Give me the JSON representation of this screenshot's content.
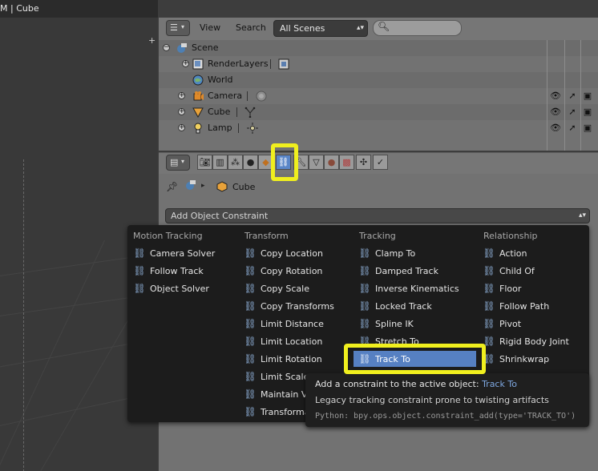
{
  "viewport": {
    "title": "M | Cube"
  },
  "outliner": {
    "menus": [
      "View",
      "Search"
    ],
    "scene_select": "All Scenes",
    "items": [
      {
        "label": "Scene"
      },
      {
        "label": "RenderLayers"
      },
      {
        "label": "World"
      },
      {
        "label": "Camera"
      },
      {
        "label": "Cube"
      },
      {
        "label": "Lamp"
      }
    ]
  },
  "properties": {
    "breadcrumb": "Cube",
    "add_constraint": "Add Object Constraint"
  },
  "menu": {
    "columns": [
      {
        "header": "Motion Tracking",
        "items": [
          "Camera Solver",
          "Follow Track",
          "Object Solver"
        ]
      },
      {
        "header": "Transform",
        "items": [
          "Copy Location",
          "Copy Rotation",
          "Copy Scale",
          "Copy Transforms",
          "Limit Distance",
          "Limit Location",
          "Limit Rotation",
          "Limit Scale",
          "Maintain Volume",
          "Transformation"
        ]
      },
      {
        "header": "Tracking",
        "items": [
          "Clamp To",
          "Damped Track",
          "Inverse Kinematics",
          "Locked Track",
          "Spline IK",
          "Stretch To",
          "Track To"
        ]
      },
      {
        "header": "Relationship",
        "items": [
          "Action",
          "Child Of",
          "Floor",
          "Follow Path",
          "Pivot",
          "Rigid Body Joint",
          "Shrinkwrap"
        ]
      }
    ],
    "highlighted": "Track To"
  },
  "tooltip": {
    "title": "Add a constraint to the active object:",
    "value": "Track To",
    "description": "Legacy tracking constraint prone to twisting artifacts",
    "python": "Python: bpy.ops.object.constraint_add(type='TRACK_TO')"
  },
  "colors": {
    "highlight_yellow": "#f0ef1e",
    "selection_blue": "#5680c2",
    "menu_bg": "#1c1c1c",
    "panel_grey": "#727272"
  }
}
